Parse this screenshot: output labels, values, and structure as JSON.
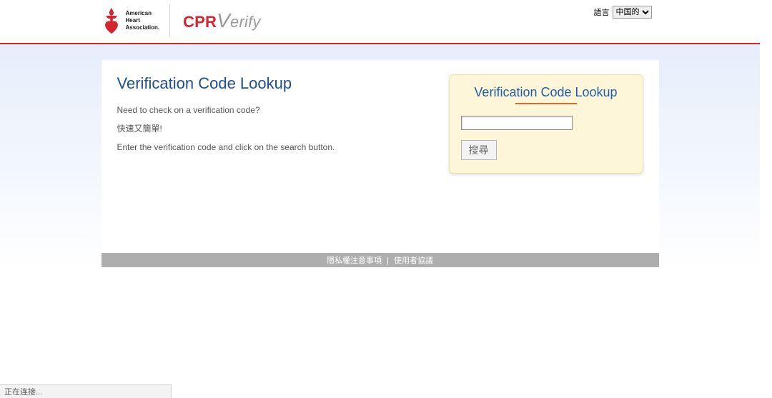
{
  "header": {
    "aha_text": "American\nHeart\nAssociation.",
    "cpr_prefix": "CPR",
    "cpr_big": "V",
    "cpr_rest": "erify"
  },
  "language": {
    "label": "語言",
    "selected": "中国的",
    "options": [
      "中国的"
    ]
  },
  "main": {
    "title": "Verification Code Lookup",
    "intro_1": "Need to check on a verification code?",
    "intro_2": "快速又簡單!",
    "intro_3": "Enter the verification code and click on the search button."
  },
  "lookup": {
    "title": "Verification Code Lookup",
    "input_value": "",
    "button": "搜尋"
  },
  "footer": {
    "privacy": "隱私權注意事項",
    "sep": "|",
    "eula": "使用者協議"
  },
  "status": {
    "text": "正在连接..."
  }
}
